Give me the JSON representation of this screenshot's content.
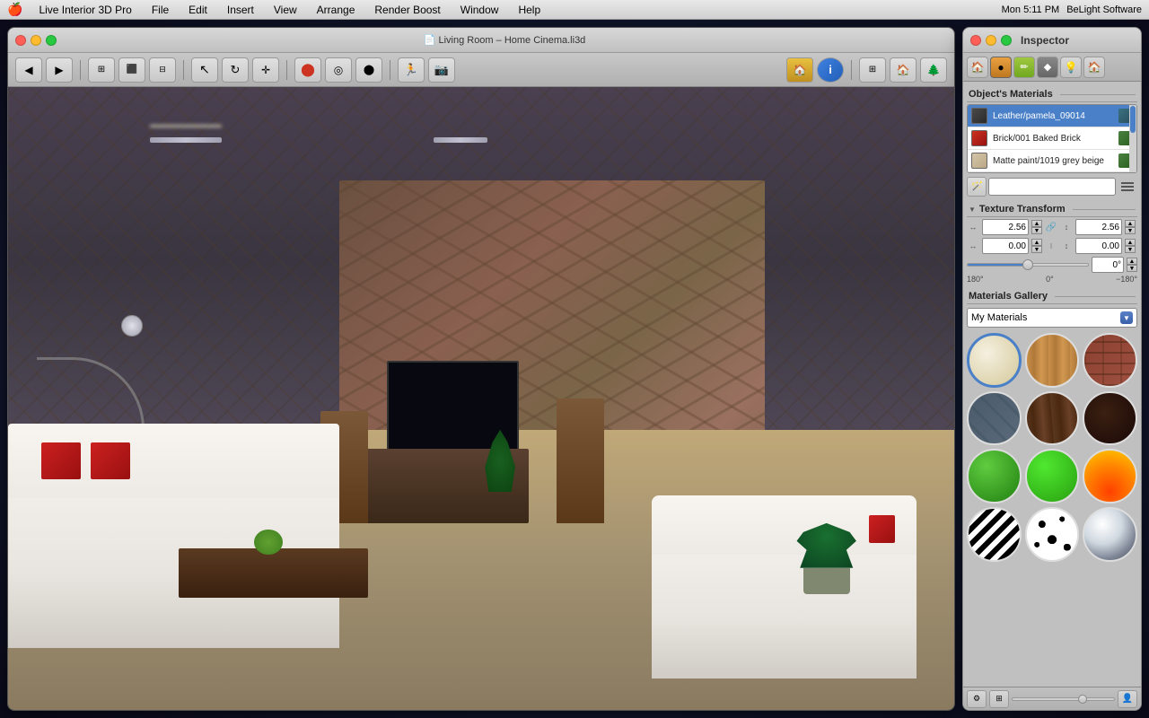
{
  "menubar": {
    "apple": "🍎",
    "items": [
      "Live Interior 3D Pro",
      "File",
      "Edit",
      "Insert",
      "View",
      "Arrange",
      "Render Boost",
      "Window",
      "Help"
    ],
    "right": [
      "Mon 5:11 PM",
      "BeLight Software"
    ]
  },
  "window": {
    "title": "Living Room – Home Cinema.li3d",
    "traffic_lights": [
      "close",
      "minimize",
      "maximize"
    ]
  },
  "toolbar": {
    "nav_back": "◀",
    "nav_fwd": "▶",
    "view_2d": "⊞",
    "view_3d": "⬛",
    "view_both": "⊟",
    "select_tool": "↖",
    "rotate_tool": "↻",
    "move_tool": "✛",
    "record_off": "⬤",
    "camera_target": "◎",
    "camera_move": "⬤",
    "walk_tool": "🚶",
    "snapshot": "📷",
    "info": "ℹ",
    "page_view": "⊞",
    "house_btn": "🏠",
    "tree_btn": "🌲"
  },
  "inspector": {
    "title": "Inspector",
    "tabs": [
      {
        "label": "🏠",
        "id": "model"
      },
      {
        "label": "●",
        "id": "material",
        "active": true
      },
      {
        "label": "✏",
        "id": "paint"
      },
      {
        "label": "◆",
        "id": "render"
      },
      {
        "label": "💡",
        "id": "light"
      },
      {
        "label": "⊞",
        "id": "view"
      }
    ],
    "materials_section": {
      "label": "Object's Materials",
      "items": [
        {
          "name": "Leather/pamela_09014",
          "color": "#4a4a4a",
          "selected": true
        },
        {
          "name": "Brick/001 Baked Brick",
          "color": "#cc3320"
        },
        {
          "name": "Matte paint/1019 grey beige",
          "color": "#d4c4a8"
        }
      ]
    },
    "texture_transform": {
      "label": "Texture Transform",
      "scale_x": "2.56",
      "scale_y": "2.56",
      "offset_x": "0.00",
      "offset_y": "0.00",
      "angle": "0°",
      "angle_min": "180°",
      "angle_zero": "0°",
      "angle_max": "−180°"
    },
    "materials_gallery": {
      "label": "Materials Gallery",
      "dropdown_value": "My Materials",
      "items": [
        {
          "id": "cream",
          "class": "gi-cream",
          "selected": true
        },
        {
          "id": "wood-light",
          "class": "gi-wood-light"
        },
        {
          "id": "brick",
          "class": "gi-brick"
        },
        {
          "id": "stone-dark",
          "class": "gi-stone-dark"
        },
        {
          "id": "wood-brown",
          "class": "gi-wood-brown"
        },
        {
          "id": "dark-brown",
          "class": "gi-dark-brown"
        },
        {
          "id": "green-ball",
          "class": "gi-green-ball"
        },
        {
          "id": "green-bright",
          "class": "gi-green-bright"
        },
        {
          "id": "fire",
          "class": "gi-fire"
        },
        {
          "id": "zebra",
          "class": "gi-zebra"
        },
        {
          "id": "spots",
          "class": "gi-spots"
        },
        {
          "id": "chrome",
          "class": "gi-chrome"
        }
      ]
    }
  }
}
